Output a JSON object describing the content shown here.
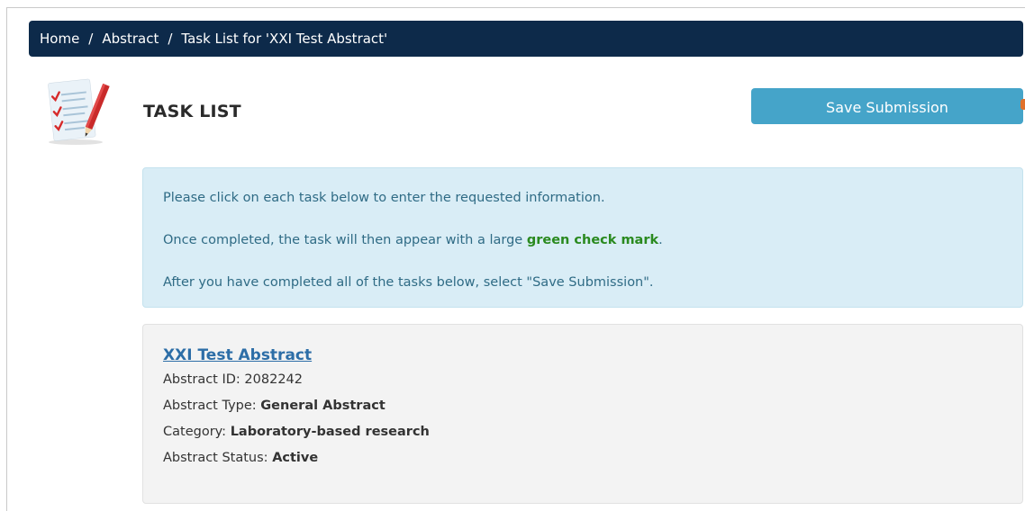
{
  "breadcrumb": {
    "home": "Home",
    "abstract": "Abstract",
    "current": "Task List for 'XXI Test Abstract'",
    "separator": "/"
  },
  "header": {
    "icon": "task-list-icon",
    "title": "TASK LIST",
    "save_label": "Save Submission"
  },
  "info": {
    "line1": "Please click on each task below to enter the requested information.",
    "line2_pre": "Once completed, the task will then appear with a large ",
    "line2_green": "green check mark",
    "line2_post": ".",
    "line3": "After you have completed all of the tasks below, select \"Save Submission\"."
  },
  "abstract": {
    "title": "XXI Test Abstract",
    "id_label": "Abstract ID: ",
    "id_value": "2082242",
    "type_label": "Abstract Type: ",
    "type_value": "General Abstract",
    "category_label": "Category: ",
    "category_value": "Laboratory-based research",
    "status_label": "Abstract Status: ",
    "status_value": "Active"
  },
  "colors": {
    "nav_bg": "#0d2a4a",
    "button_bg": "#45a4c9",
    "info_bg": "#d9edf6",
    "info_text": "#2f6b85",
    "success_green": "#2a8a1f",
    "link_blue": "#2d6ea7",
    "card_bg": "#f3f3f3"
  }
}
